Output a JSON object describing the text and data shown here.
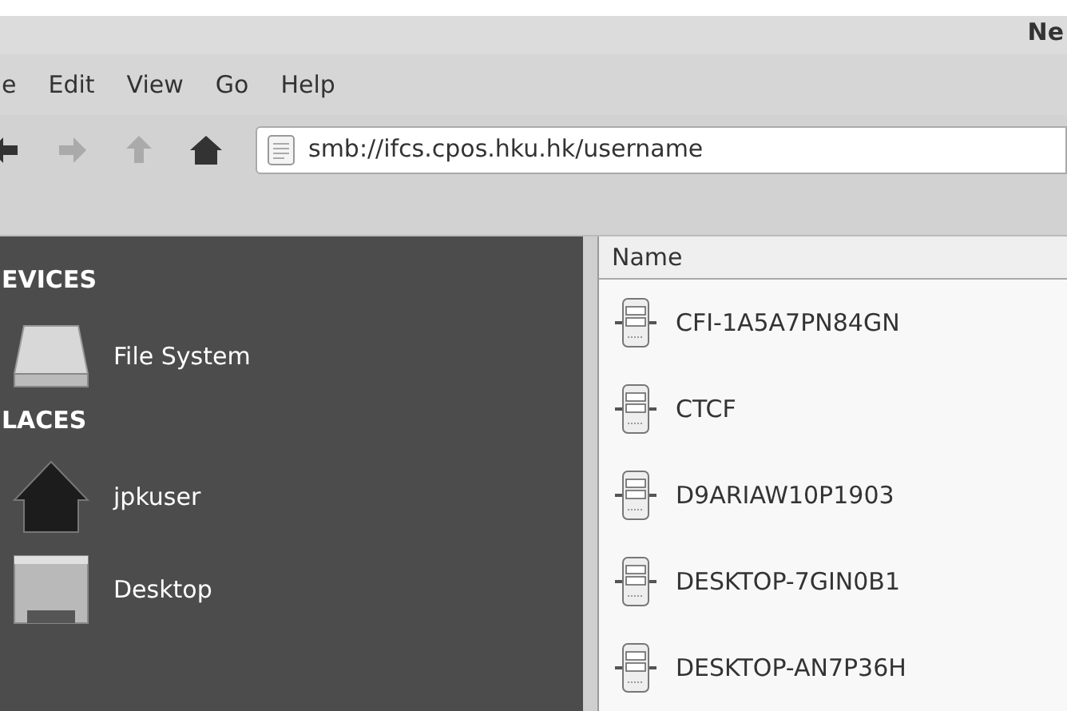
{
  "window": {
    "title": "Ne"
  },
  "menu": [
    "e",
    "Edit",
    "View",
    "Go",
    "Help"
  ],
  "toolbar": {
    "location": "smb://ifcs.cpos.hku.hk/username"
  },
  "sidebar": {
    "sections": [
      {
        "heading": "EVICES",
        "items": [
          {
            "label": "File System",
            "kind": "drive"
          }
        ]
      },
      {
        "heading": "LACES",
        "items": [
          {
            "label": "jpkuser",
            "kind": "home"
          },
          {
            "label": "Desktop",
            "kind": "desktop"
          }
        ]
      }
    ]
  },
  "file_list": {
    "columns": [
      "Name"
    ],
    "rows": [
      {
        "name": "CFI-1A5A7PN84GN"
      },
      {
        "name": "CTCF"
      },
      {
        "name": "D9ARIAW10P1903"
      },
      {
        "name": "DESKTOP-7GIN0B1"
      },
      {
        "name": "DESKTOP-AN7P36H"
      }
    ]
  }
}
